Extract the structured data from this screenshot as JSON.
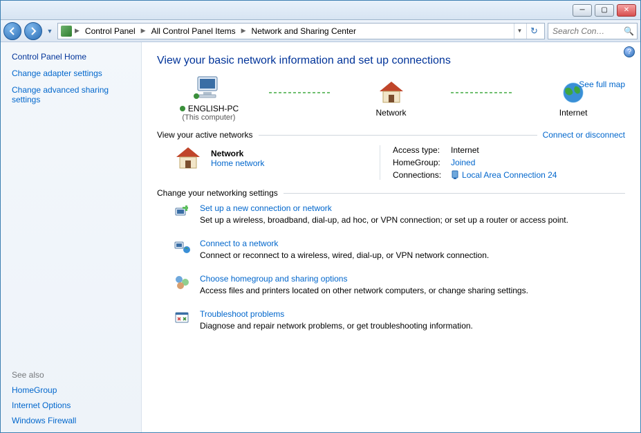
{
  "window": {
    "min_tip": "Minimize",
    "max_tip": "Maximize",
    "close_tip": "Close"
  },
  "nav": {
    "breadcrumbs": [
      "Control Panel",
      "All Control Panel Items",
      "Network and Sharing Center"
    ],
    "search_placeholder": "Search Con…"
  },
  "sidebar": {
    "home": "Control Panel Home",
    "links": [
      "Change adapter settings",
      "Change advanced sharing settings"
    ],
    "see_also_head": "See also",
    "see_also": [
      "HomeGroup",
      "Internet Options",
      "Windows Firewall"
    ]
  },
  "main": {
    "title": "View your basic network information and set up connections",
    "map": {
      "this_pc": "ENGLISH-PC",
      "this_pc_sub": "(This computer)",
      "network": "Network",
      "internet": "Internet",
      "see_full_map": "See full map"
    },
    "active_head": "View your active networks",
    "connect_disconnect": "Connect or disconnect",
    "network_card": {
      "name": "Network",
      "type_link": "Home network",
      "access_type_label": "Access type:",
      "access_type_value": "Internet",
      "homegroup_label": "HomeGroup:",
      "homegroup_value": "Joined",
      "connections_label": "Connections:",
      "connections_value": "Local Area Connection 24"
    },
    "change_head": "Change your networking settings",
    "tasks": [
      {
        "title": "Set up a new connection or network",
        "desc": "Set up a wireless, broadband, dial-up, ad hoc, or VPN connection; or set up a router or access point."
      },
      {
        "title": "Connect to a network",
        "desc": "Connect or reconnect to a wireless, wired, dial-up, or VPN network connection."
      },
      {
        "title": "Choose homegroup and sharing options",
        "desc": "Access files and printers located on other network computers, or change sharing settings."
      },
      {
        "title": "Troubleshoot problems",
        "desc": "Diagnose and repair network problems, or get troubleshooting information."
      }
    ]
  }
}
